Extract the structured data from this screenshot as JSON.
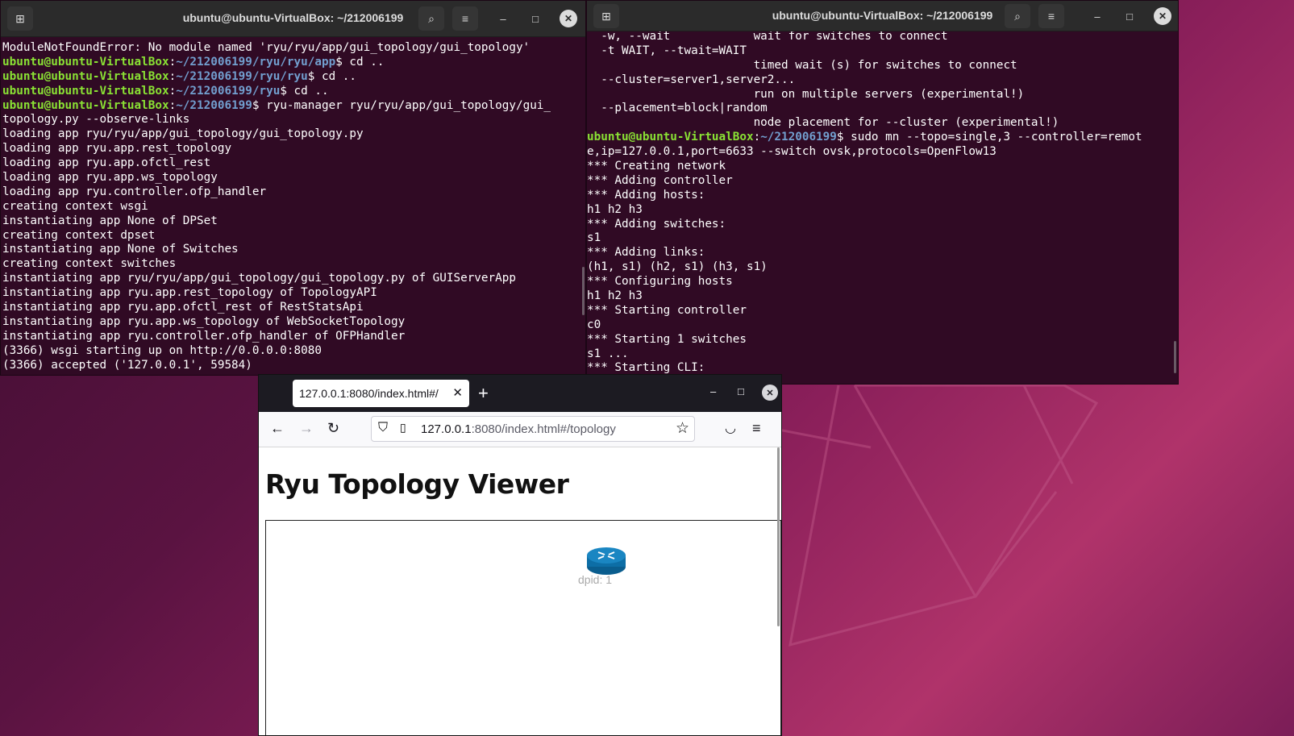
{
  "colors": {
    "terminal_bg": "#300a24",
    "prompt_user": "#8ae234",
    "prompt_path": "#729fcf",
    "switch_icon": "#0d6ea6",
    "browser_chrome": "#1c1b22"
  },
  "left_terminal": {
    "title": "ubuntu@ubuntu-VirtualBox: ~/212006199",
    "icons": [
      "new-tab-icon",
      "search-icon",
      "menu-icon",
      "minimize-icon",
      "maximize-icon",
      "close-icon"
    ],
    "lines": [
      {
        "plain": "ModuleNotFoundError: No module named 'ryu/ryu/app/gui_topology/gui_topology'"
      },
      {
        "user": "ubuntu@ubuntu-VirtualBox",
        "sep": ":",
        "path": "~/212006199/ryu/ryu/app",
        "cmd": "$ cd .."
      },
      {
        "user": "ubuntu@ubuntu-VirtualBox",
        "sep": ":",
        "path": "~/212006199/ryu/ryu",
        "cmd": "$ cd .."
      },
      {
        "user": "ubuntu@ubuntu-VirtualBox",
        "sep": ":",
        "path": "~/212006199/ryu",
        "cmd": "$ cd .."
      },
      {
        "user": "ubuntu@ubuntu-VirtualBox",
        "sep": ":",
        "path": "~/212006199",
        "cmd": "$ ryu-manager ryu/ryu/app/gui_topology/gui_"
      },
      {
        "plain": "topology.py --observe-links"
      },
      {
        "plain": "loading app ryu/ryu/app/gui_topology/gui_topology.py"
      },
      {
        "plain": "loading app ryu.app.rest_topology"
      },
      {
        "plain": "loading app ryu.app.ofctl_rest"
      },
      {
        "plain": "loading app ryu.app.ws_topology"
      },
      {
        "plain": "loading app ryu.controller.ofp_handler"
      },
      {
        "plain": "creating context wsgi"
      },
      {
        "plain": "instantiating app None of DPSet"
      },
      {
        "plain": "creating context dpset"
      },
      {
        "plain": "instantiating app None of Switches"
      },
      {
        "plain": "creating context switches"
      },
      {
        "plain": "instantiating app ryu/ryu/app/gui_topology/gui_topology.py of GUIServerApp"
      },
      {
        "plain": "instantiating app ryu.app.rest_topology of TopologyAPI"
      },
      {
        "plain": "instantiating app ryu.app.ofctl_rest of RestStatsApi"
      },
      {
        "plain": "instantiating app ryu.app.ws_topology of WebSocketTopology"
      },
      {
        "plain": "instantiating app ryu.controller.ofp_handler of OFPHandler"
      },
      {
        "plain": "(3366) wsgi starting up on http://0.0.0.0:8080"
      },
      {
        "plain": "(3366) accepted ('127.0.0.1', 59584)"
      }
    ]
  },
  "right_terminal": {
    "title": "ubuntu@ubuntu-VirtualBox: ~/212006199",
    "lines": [
      {
        "plain": "  -w, --wait            wait for switches to connect"
      },
      {
        "plain": "  -t WAIT, --twait=WAIT"
      },
      {
        "plain": "                        timed wait (s) for switches to connect"
      },
      {
        "plain": "  --cluster=server1,server2..."
      },
      {
        "plain": "                        run on multiple servers (experimental!)"
      },
      {
        "plain": "  --placement=block|random"
      },
      {
        "plain": "                        node placement for --cluster (experimental!)"
      },
      {
        "user": "ubuntu@ubuntu-VirtualBox",
        "sep": ":",
        "path": "~/212006199",
        "cmd": "$ sudo mn --topo=single,3 --controller=remot"
      },
      {
        "plain": "e,ip=127.0.0.1,port=6633 --switch ovsk,protocols=OpenFlow13"
      },
      {
        "plain": "*** Creating network"
      },
      {
        "plain": "*** Adding controller"
      },
      {
        "plain": "*** Adding hosts:"
      },
      {
        "plain": "h1 h2 h3"
      },
      {
        "plain": "*** Adding switches:"
      },
      {
        "plain": "s1"
      },
      {
        "plain": "*** Adding links:"
      },
      {
        "plain": "(h1, s1) (h2, s1) (h3, s1)"
      },
      {
        "plain": "*** Configuring hosts"
      },
      {
        "plain": "h1 h2 h3"
      },
      {
        "plain": "*** Starting controller"
      },
      {
        "plain": "c0"
      },
      {
        "plain": "*** Starting 1 switches"
      },
      {
        "plain": "s1 ..."
      },
      {
        "plain": "*** Starting CLI:"
      }
    ]
  },
  "browser": {
    "tab_title": "127.0.0.1:8080/index.html#/",
    "url_host": "127.0.0.1",
    "url_rest": ":8080/index.html#/topology",
    "page_title": "Ryu Topology Viewer",
    "switch_label": "dpid: 1"
  }
}
